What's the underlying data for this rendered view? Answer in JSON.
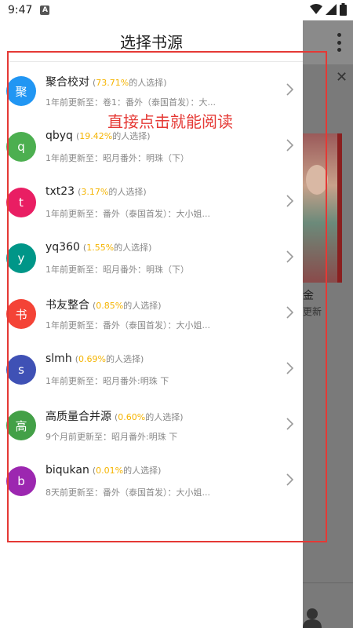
{
  "status_bar": {
    "time": "9:47",
    "notification_badge": "A"
  },
  "drawer": {
    "title": "选择书源",
    "sources": [
      {
        "avatar": "聚",
        "color": "#2196f3",
        "name": "聚合校对",
        "percent": "73.71%",
        "suffix": "的人选择)",
        "update": "1年前更新至：卷1：番外（泰国首发）：大..."
      },
      {
        "avatar": "q",
        "color": "#4caf50",
        "name": "qbyq",
        "percent": "19.42%",
        "suffix": "的人选择)",
        "update": "1年前更新至：昭月番外：明珠（下）"
      },
      {
        "avatar": "t",
        "color": "#e91e63",
        "name": "txt23",
        "percent": "3.17%",
        "suffix": "的人选择)",
        "update": "1年前更新至：番外（泰国首发）：大小姐..."
      },
      {
        "avatar": "y",
        "color": "#009688",
        "name": "yq360",
        "percent": "1.55%",
        "suffix": "的人选择)",
        "update": "1年前更新至：昭月番外：明珠（下）"
      },
      {
        "avatar": "书",
        "color": "#f44336",
        "name": "书友整合",
        "percent": "0.85%",
        "suffix": "的人选择)",
        "update": "1年前更新至：番外（泰国首发）：大小姐..."
      },
      {
        "avatar": "s",
        "color": "#3f51b5",
        "name": "slmh",
        "percent": "0.69%",
        "suffix": "的人选择)",
        "update": "1年前更新至：昭月番外:明珠 下"
      },
      {
        "avatar": "高",
        "color": "#43a047",
        "name": "高质量合并源",
        "percent": "0.60%",
        "suffix": "的人选择)",
        "update": "9个月前更新至：昭月番外:明珠 下"
      },
      {
        "avatar": "b",
        "color": "#9c27b0",
        "name": "biqukan",
        "percent": "0.01%",
        "suffix": "的人选择)",
        "update": "8天前更新至：番外（泰国首发）：大小姐..."
      }
    ]
  },
  "annotation": {
    "text": "直接点击就能阅读"
  },
  "background": {
    "book_title": "金",
    "book_sub": "更新",
    "nav_mine": "我的"
  }
}
